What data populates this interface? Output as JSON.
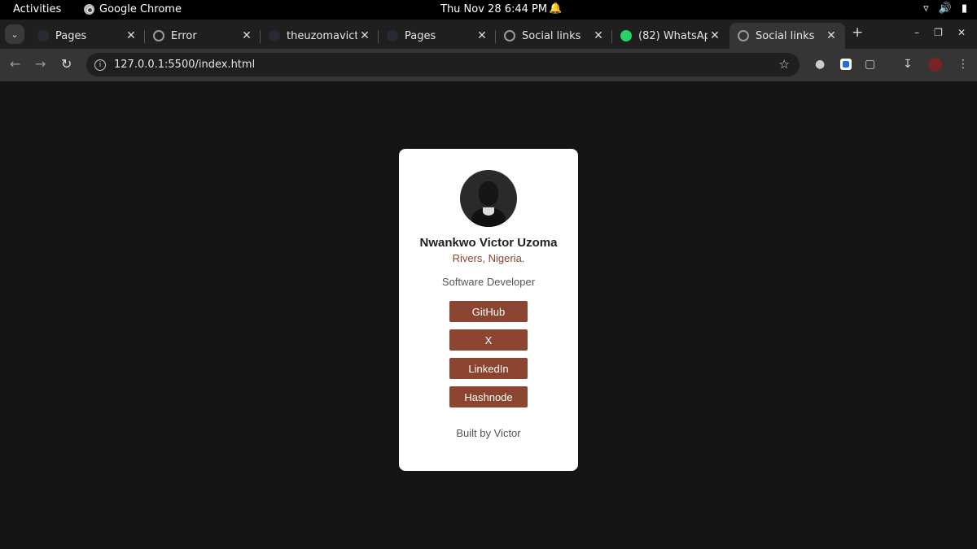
{
  "os": {
    "activities": "Activities",
    "app_name": "Google Chrome",
    "clock": "Thu Nov 28  6:44 PM"
  },
  "tabs": [
    {
      "label": "Pages",
      "favicon": "dark-circle-icon"
    },
    {
      "label": "Error",
      "favicon": "globe-icon"
    },
    {
      "label": "theuzomavict",
      "favicon": "dark-circle-icon"
    },
    {
      "label": "Pages",
      "favicon": "dark-circle-icon"
    },
    {
      "label": "Social links",
      "favicon": "globe-icon"
    },
    {
      "label": "(82) WhatsAp",
      "favicon": "whatsapp-icon"
    },
    {
      "label": "Social links",
      "favicon": "globe-icon",
      "active": true
    }
  ],
  "address_bar": {
    "url": "127.0.0.1:5500/index.html"
  },
  "profile": {
    "name": "Nwankwo Victor Uzoma",
    "location": "Rivers, Nigeria.",
    "role": "Software Developer",
    "links": [
      {
        "label": "GitHub"
      },
      {
        "label": "X"
      },
      {
        "label": "LinkedIn"
      },
      {
        "label": "Hashnode"
      }
    ],
    "footer": "Built by Victor"
  },
  "colors": {
    "page_background": "#141414",
    "card_background": "#ffffff",
    "accent": "#8a4430"
  }
}
